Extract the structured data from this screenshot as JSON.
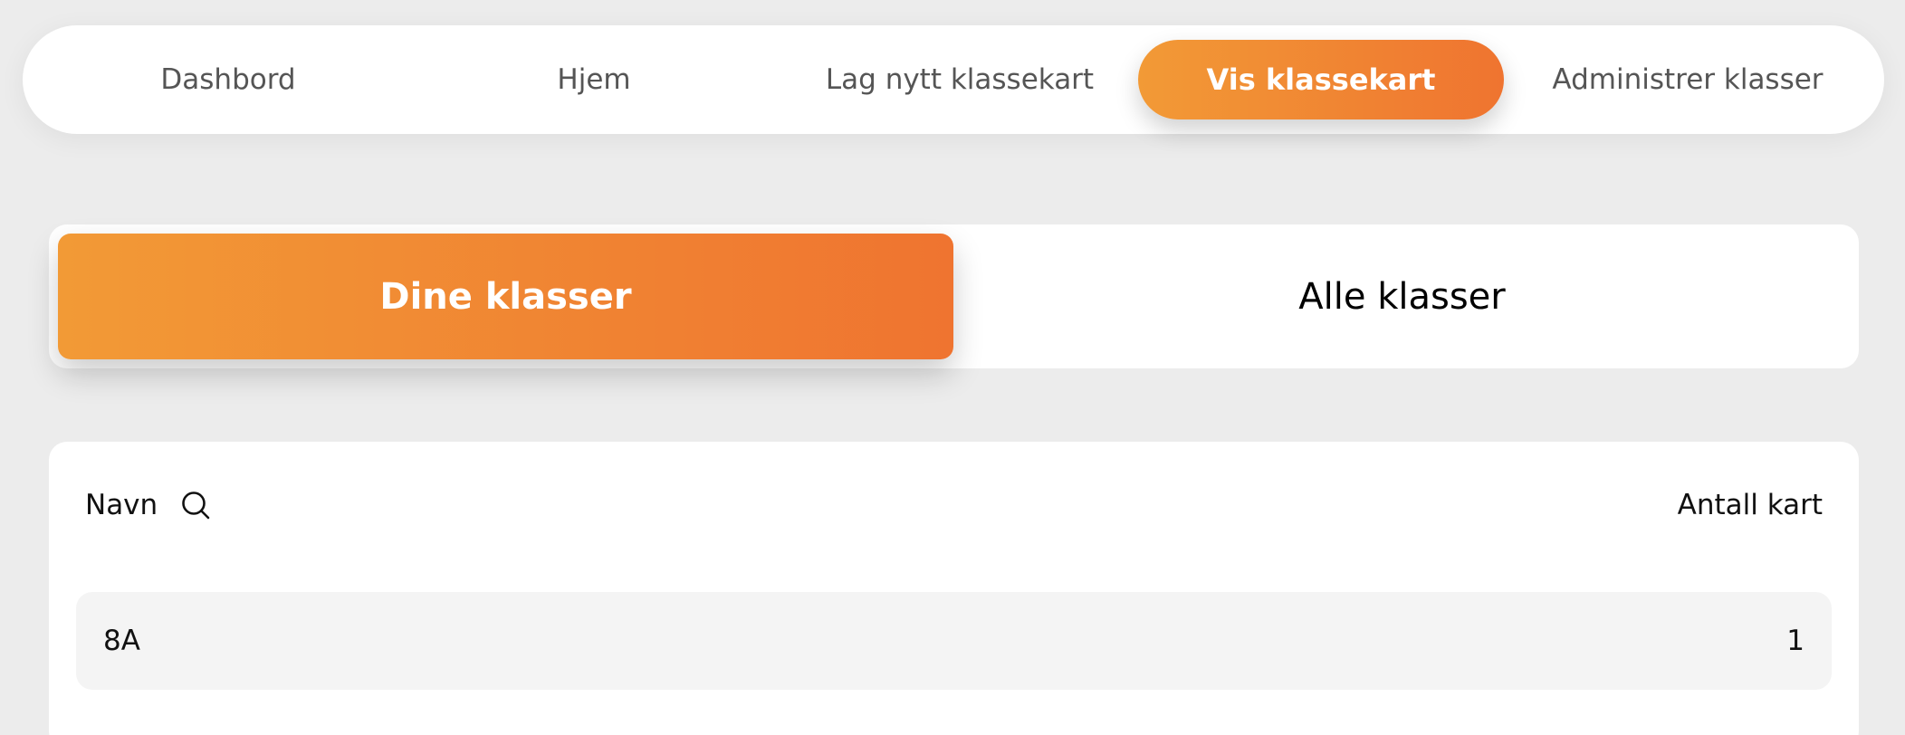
{
  "nav": {
    "items": [
      {
        "label": "Dashbord"
      },
      {
        "label": "Hjem"
      },
      {
        "label": "Lag nytt klassekart"
      },
      {
        "label": "Vis klassekart"
      },
      {
        "label": "Administrer klasser"
      }
    ],
    "active": "Vis klassekart"
  },
  "toggle": {
    "options": [
      "Dine klasser",
      "Alle klasser"
    ],
    "selected": "Dine klasser"
  },
  "table": {
    "headers": {
      "name": "Navn",
      "count": "Antall kart"
    },
    "rows": [
      {
        "name": "8A",
        "count": "1"
      }
    ]
  },
  "icons": {
    "search": "search-icon"
  },
  "colors": {
    "accent_start": "#f29a36",
    "accent_end": "#ef7430",
    "background": "#ececec",
    "row_background": "#f4f4f4"
  }
}
